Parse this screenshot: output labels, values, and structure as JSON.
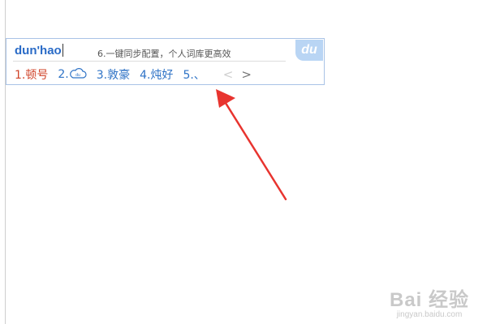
{
  "ime": {
    "composition": "dun'hao",
    "tip": "6.一键同步配置，个人词库更高效",
    "logo_text": "du",
    "candidates": [
      {
        "label": "1.顿号"
      },
      {
        "label": "2."
      },
      {
        "label": "3.敦豪"
      },
      {
        "label": "4.炖好"
      },
      {
        "label": "5.、"
      }
    ],
    "prev_icon": "chevron-left-icon",
    "next_icon": "chevron-right-icon"
  },
  "watermark": {
    "main": "Bai 经验",
    "sub": "jingyan.baidu.com"
  },
  "colors": {
    "accent": "#2f73c6",
    "first_candidate": "#d0442a",
    "annotation_arrow": "#e8342f",
    "border": "#a9c3e6"
  }
}
